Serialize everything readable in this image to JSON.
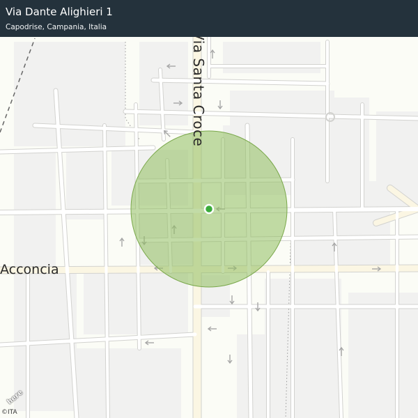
{
  "header": {
    "address_title": "Via Dante Alighieri 1",
    "address_subtitle": "Capodrise, Campania, Italia"
  },
  "map": {
    "street_labels": {
      "santa_croce": "Via Santa Croce",
      "acconcia": "Acconcia"
    },
    "logo": "here",
    "copyright": "©ITA",
    "colors": {
      "background": "#fbfcf6",
      "block": "#f1f1f0",
      "road_minor": "#ffffff",
      "road_major": "#fbf6e3",
      "road_casing": "#d2d2cf",
      "radius_fill": "#8fbd5f",
      "location_dot": "#3bab3b",
      "header_bg": "#24323c"
    }
  }
}
